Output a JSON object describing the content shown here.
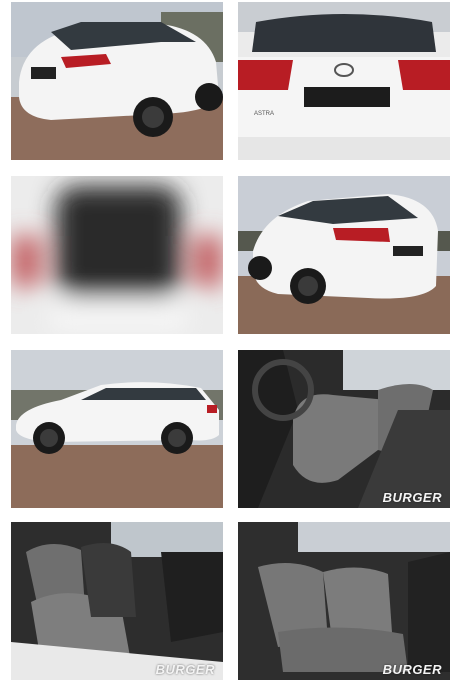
{
  "gallery": {
    "photos": [
      {
        "id": 1,
        "subject": "rear-three-quarter-left",
        "watermark": ""
      },
      {
        "id": 2,
        "subject": "rear-close-up",
        "watermark": ""
      },
      {
        "id": 3,
        "subject": "blurred-trunk",
        "watermark": ""
      },
      {
        "id": 4,
        "subject": "rear-three-quarter-right",
        "watermark": ""
      },
      {
        "id": 5,
        "subject": "side-profile",
        "watermark": ""
      },
      {
        "id": 6,
        "subject": "front-seats-driver",
        "watermark": "BURGER"
      },
      {
        "id": 7,
        "subject": "front-seats-passenger",
        "watermark": "BURGER"
      },
      {
        "id": 8,
        "subject": "rear-seats",
        "watermark": "BURGER"
      }
    ],
    "badge_text": "ASTRA"
  },
  "colors": {
    "car_body": "#f3f3f3",
    "tail_light": "#b81d24",
    "seat_fabric": "#7a7a7a",
    "ground": "#8a6a58",
    "sky": "#c9cdd2"
  }
}
